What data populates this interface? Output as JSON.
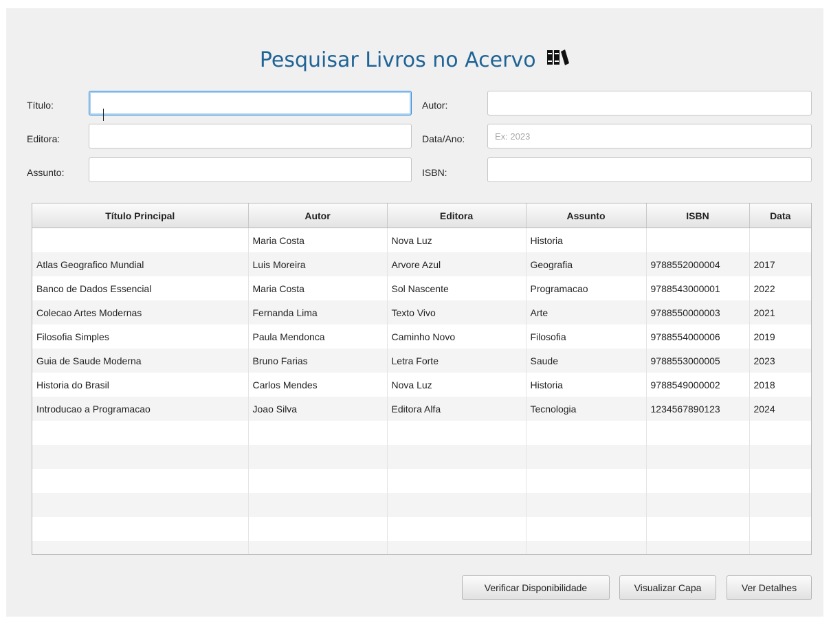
{
  "page": {
    "title": "Pesquisar Livros no Acervo"
  },
  "form": {
    "titulo": {
      "label": "Título:",
      "value": "",
      "placeholder": ""
    },
    "autor": {
      "label": "Autor:",
      "value": "",
      "placeholder": ""
    },
    "editora": {
      "label": "Editora:",
      "value": "",
      "placeholder": ""
    },
    "data_ano": {
      "label": "Data/Ano:",
      "value": "",
      "placeholder": "Ex: 2023"
    },
    "assunto": {
      "label": "Assunto:",
      "value": "",
      "placeholder": ""
    },
    "isbn": {
      "label": "ISBN:",
      "value": "",
      "placeholder": ""
    }
  },
  "table": {
    "columns": [
      "Título Principal",
      "Autor",
      "Editora",
      "Assunto",
      "ISBN",
      "Data"
    ],
    "rows": [
      [
        "",
        "Maria Costa",
        "Nova Luz",
        "Historia",
        "",
        ""
      ],
      [
        "Atlas Geografico Mundial",
        "Luis Moreira",
        "Arvore Azul",
        "Geografia",
        "9788552000004",
        "2017"
      ],
      [
        "Banco de Dados Essencial",
        "Maria Costa",
        "Sol Nascente",
        "Programacao",
        "9788543000001",
        "2022"
      ],
      [
        "Colecao Artes Modernas",
        "Fernanda Lima",
        "Texto Vivo",
        "Arte",
        "9788550000003",
        "2021"
      ],
      [
        "Filosofia Simples",
        "Paula Mendonca",
        "Caminho Novo",
        "Filosofia",
        "9788554000006",
        "2019"
      ],
      [
        "Guia de Saude Moderna",
        "Bruno Farias",
        "Letra Forte",
        "Saude",
        "9788553000005",
        "2023"
      ],
      [
        "Historia do Brasil",
        "Carlos Mendes",
        "Nova Luz",
        "Historia",
        "9788549000002",
        "2018"
      ],
      [
        "Introducao a Programacao",
        "Joao Silva",
        "Editora Alfa",
        "Tecnologia",
        "1234567890123",
        "2024"
      ]
    ]
  },
  "buttons": {
    "verificar": "Verificar Disponibilidade",
    "visualizar": "Visualizar Capa",
    "detalhes": "Ver Detalhes"
  },
  "colors": {
    "title": "#1f6496",
    "focus_border": "#3a8fd6"
  },
  "icons": {
    "title_icon": "books-icon"
  }
}
